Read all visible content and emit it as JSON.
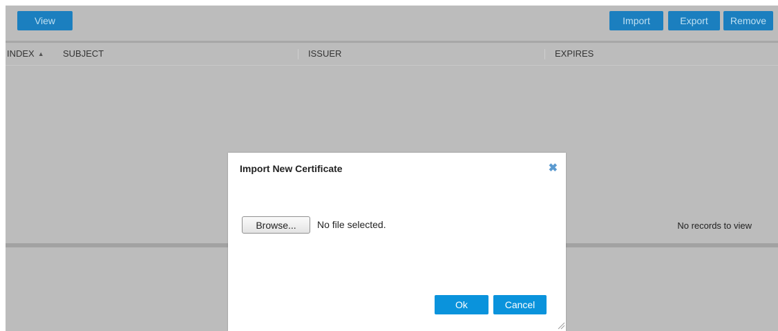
{
  "toolbar": {
    "view_label": "View",
    "import_label": "Import",
    "export_label": "Export",
    "remove_label": "Remove"
  },
  "table": {
    "columns": [
      "INDEX",
      "SUBJECT",
      "ISSUER",
      "EXPIRES"
    ],
    "empty_message": "No records to view"
  },
  "dialog": {
    "title": "Import New Certificate",
    "close_icon": "close-icon",
    "browse_label": "Browse...",
    "file_status": "No file selected.",
    "ok_label": "Ok",
    "cancel_label": "Cancel"
  },
  "colors": {
    "button_blue": "#1b7fbf",
    "dialog_button_blue": "#0a93dc",
    "overlay_gray": "#bcbcbc"
  }
}
